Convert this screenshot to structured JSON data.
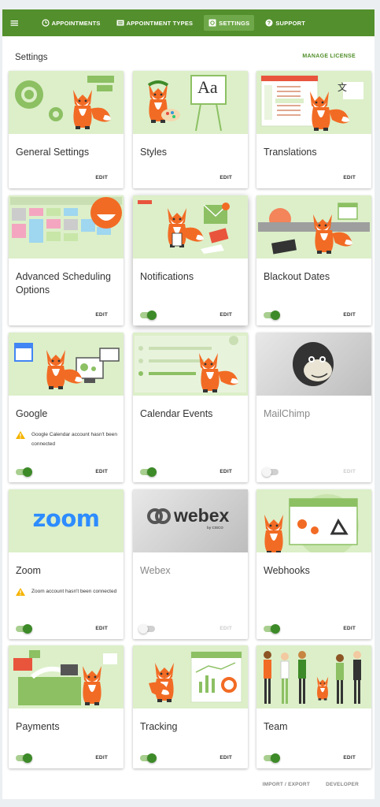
{
  "nav": {
    "menu_icon": "hamburger-icon",
    "items": [
      {
        "label": "APPOINTMENTS",
        "icon": "clock-icon"
      },
      {
        "label": "APPOINTMENT TYPES",
        "icon": "list-icon"
      },
      {
        "label": "SETTINGS",
        "icon": "gear-icon"
      },
      {
        "label": "SUPPORT",
        "icon": "help-icon"
      }
    ],
    "active": "SETTINGS",
    "bg_color": "#538f2c"
  },
  "page": {
    "title": "Settings",
    "manage_license": "MANAGE LICENSE"
  },
  "cards": [
    {
      "title": "General Settings",
      "action": "EDIT"
    },
    {
      "title": "Styles",
      "action": "EDIT"
    },
    {
      "title": "Translations",
      "action": "EDIT"
    },
    {
      "title": "Advanced Scheduling Options",
      "action": "EDIT"
    },
    {
      "title": "Notifications",
      "action": "EDIT",
      "enabled": true
    },
    {
      "title": "Blackout Dates",
      "action": "EDIT",
      "enabled": true
    },
    {
      "title": "Google",
      "action": "EDIT",
      "enabled": true,
      "warning": "Google Calendar account hasn't been connected"
    },
    {
      "title": "Calendar Events",
      "action": "EDIT",
      "enabled": true
    },
    {
      "title": "MailChimp",
      "action": "EDIT",
      "enabled": false
    },
    {
      "title": "Zoom",
      "action": "EDIT",
      "enabled": true,
      "warning": "Zoom account hasn't been connected",
      "logo_text": "zoom"
    },
    {
      "title": "Webex",
      "action": "EDIT",
      "enabled": false,
      "logo_text": "webex",
      "logo_sub": "by CISCO"
    },
    {
      "title": "Webhooks",
      "action": "EDIT",
      "enabled": true
    },
    {
      "title": "Payments",
      "action": "EDIT",
      "enabled": true
    },
    {
      "title": "Tracking",
      "action": "EDIT",
      "enabled": true
    },
    {
      "title": "Team",
      "action": "EDIT",
      "enabled": true
    }
  ],
  "thumb_texts": {
    "styles_sample": "Aa",
    "translations_sample": "文"
  },
  "footer": {
    "import_export": "IMPORT / EXPORT",
    "developer": "DEVELOPER"
  },
  "colors": {
    "accent": "#538f2c",
    "toggle_on": "#3d8a28",
    "warning": "#f5b400",
    "thumb_bg": "#dcefc9",
    "zoom_blue": "#2d8cff"
  }
}
